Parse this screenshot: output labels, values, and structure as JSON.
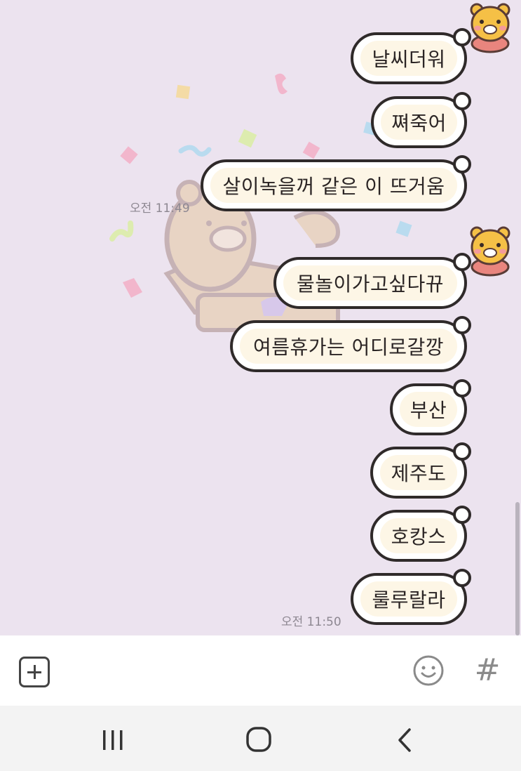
{
  "messages": [
    {
      "text": "날씨더워"
    },
    {
      "text": "쪄죽어"
    },
    {
      "text": "살이녹을꺼 같은 이 뜨거움"
    },
    {
      "text": "물놀이가고싶다뀨"
    },
    {
      "text": "여름휴가는 어디로갈깡"
    },
    {
      "text": "부산"
    },
    {
      "text": "제주도"
    },
    {
      "text": "호캉스"
    },
    {
      "text": "룰루랄라"
    }
  ],
  "timestamps": {
    "first": "오전 11:49",
    "second": "오전 11:50"
  },
  "input_bar": {
    "hash_symbol": "#",
    "attach_icon": "plus-square-icon",
    "emoji_icon": "smiley-icon"
  },
  "nav": {
    "recents_icon": "recents-icon",
    "home_icon": "home-icon",
    "back_icon": "back-icon"
  },
  "colors": {
    "chat_background": "#ece3ef",
    "bubble_fill": "#fdf6e6",
    "bubble_border": "#2f2a2a"
  }
}
